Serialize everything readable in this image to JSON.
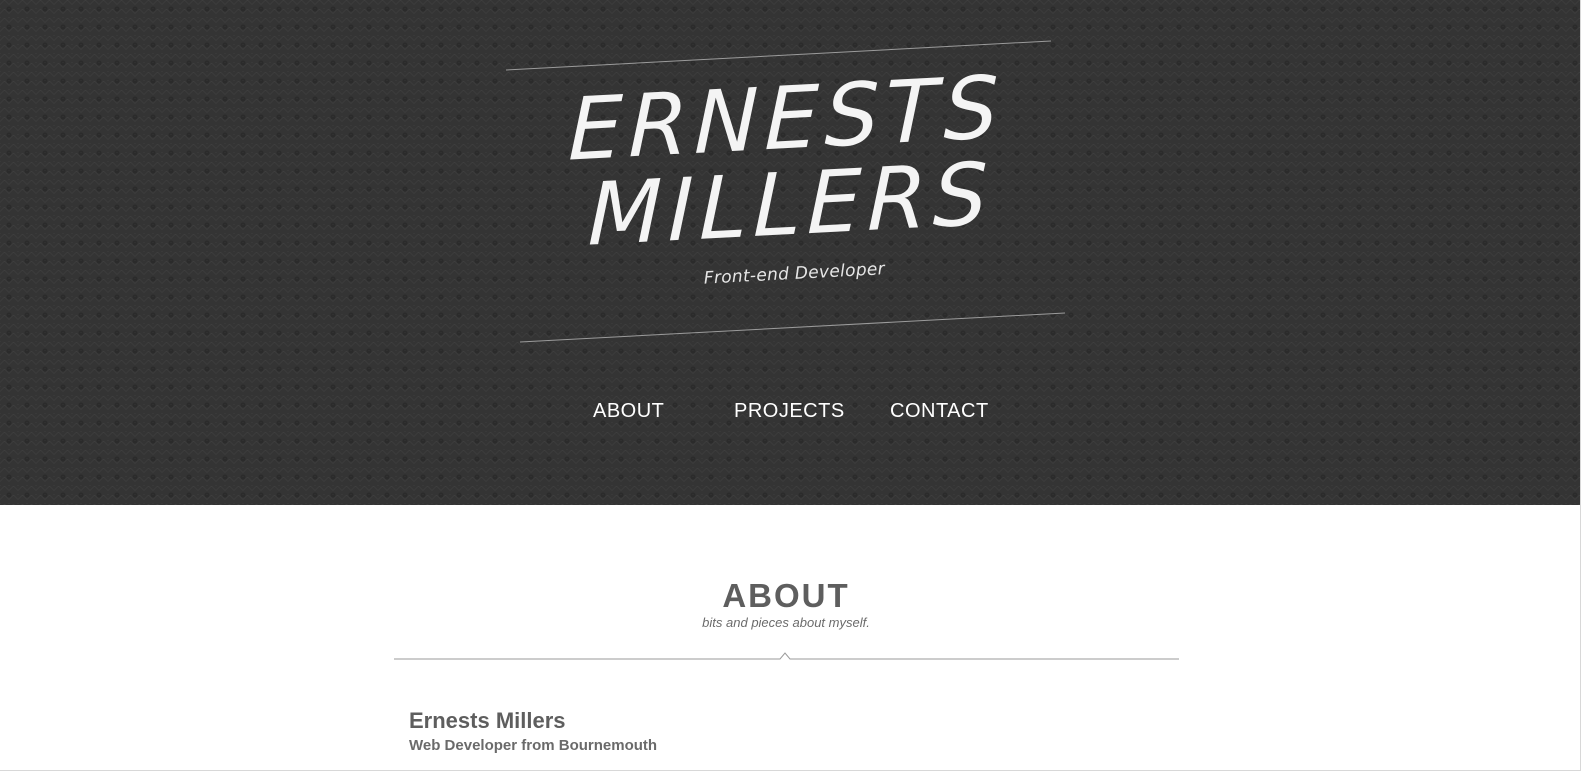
{
  "header": {
    "logo_line_1": "ERNESTS",
    "logo_line_2": "MILLERS",
    "tagline": "Front-end Developer"
  },
  "nav": {
    "items": [
      {
        "label": "ABOUT"
      },
      {
        "label": "PROJECTS"
      },
      {
        "label": "CONTACT"
      }
    ]
  },
  "about": {
    "title": "ABOUT",
    "subtitle": "bits and pieces about myself.",
    "name": "Ernests Millers",
    "role": "Web Developer from Bournemouth"
  },
  "colors": {
    "header_background": "#343434",
    "header_text": "#ffffff",
    "body_background": "#ffffff",
    "body_text": "#5e5e5e",
    "divider": "#9a9a9a"
  }
}
